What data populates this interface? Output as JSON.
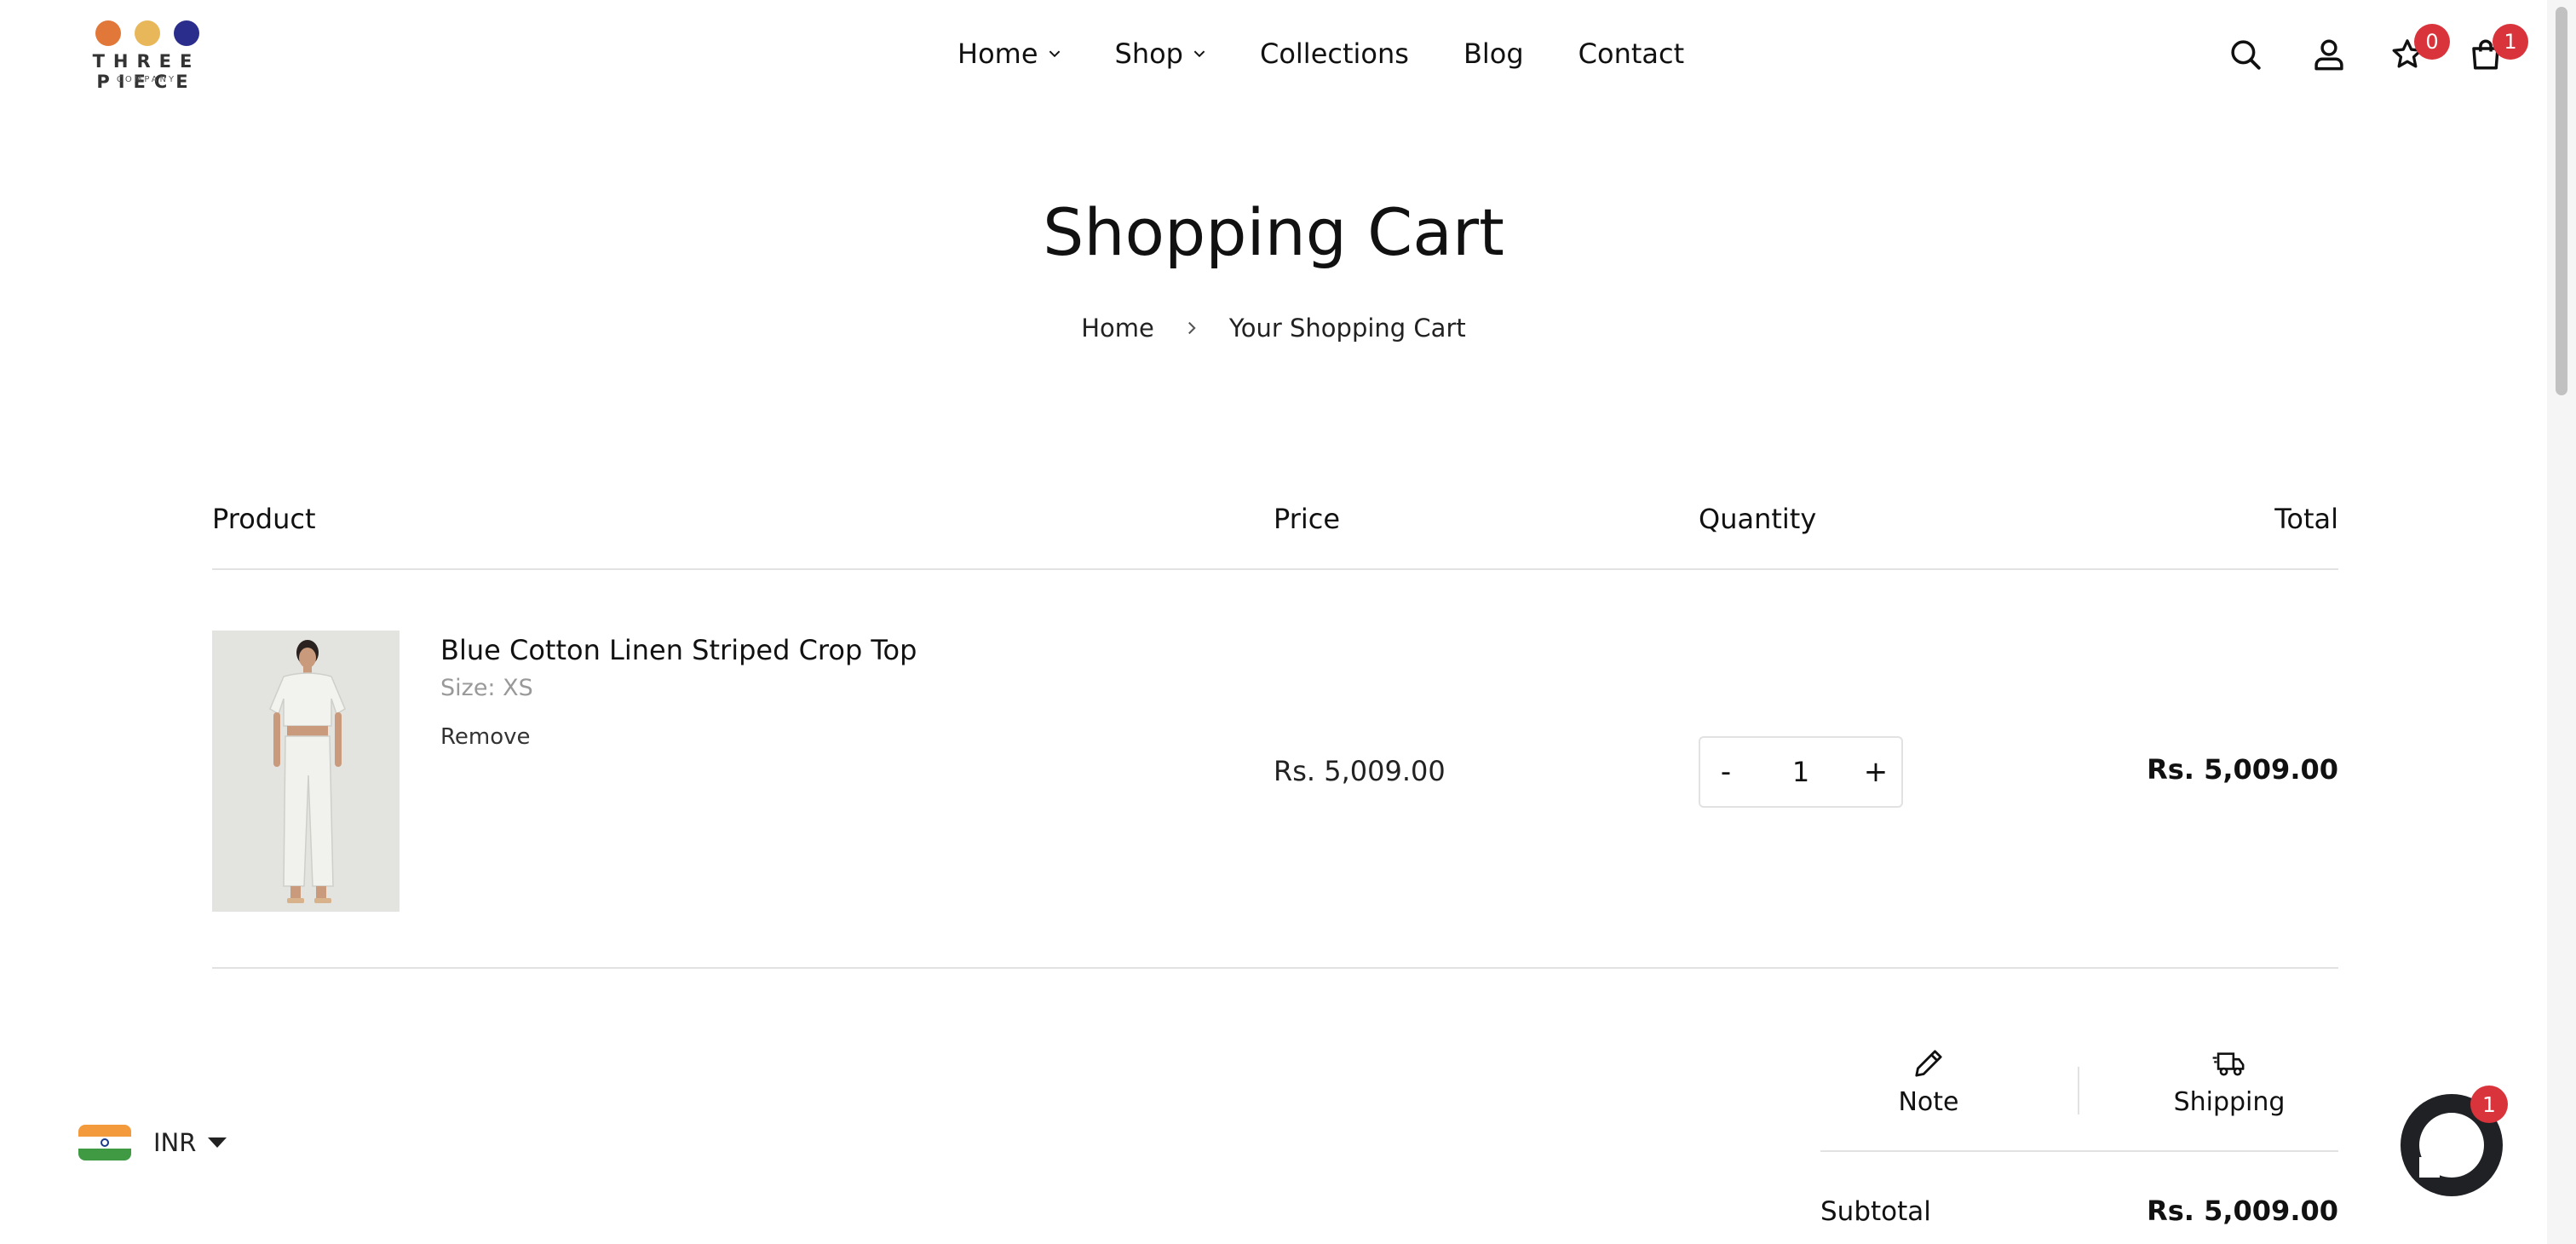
{
  "brand": {
    "name": "THREE PIECE",
    "tagline": "COMPANY",
    "dot_colors": [
      "#e2773a",
      "#e8b75a",
      "#2a2d8c"
    ]
  },
  "nav": {
    "items": [
      {
        "label": "Home",
        "has_dropdown": true
      },
      {
        "label": "Shop",
        "has_dropdown": true
      },
      {
        "label": "Collections",
        "has_dropdown": false
      },
      {
        "label": "Blog",
        "has_dropdown": false
      },
      {
        "label": "Contact",
        "has_dropdown": false
      }
    ]
  },
  "header_icons": {
    "search": "search-icon",
    "account": "user-icon",
    "wishlist": "star-icon",
    "wishlist_count": "0",
    "cart": "shopping-bag-icon",
    "cart_count": "1"
  },
  "page": {
    "title": "Shopping Cart",
    "breadcrumb": [
      "Home",
      "Your Shopping Cart"
    ]
  },
  "cart": {
    "columns": {
      "product": "Product",
      "price": "Price",
      "quantity": "Quantity",
      "total": "Total"
    },
    "items": [
      {
        "name": "Blue Cotton Linen Striped Crop Top",
        "variant": "Size: XS",
        "remove_label": "Remove",
        "price": "Rs. 5,009.00",
        "quantity": "1",
        "total": "Rs. 5,009.00"
      }
    ],
    "qty_minus": "-",
    "qty_plus": "+"
  },
  "summary": {
    "note_label": "Note",
    "shipping_label": "Shipping",
    "subtotal_label": "Subtotal",
    "subtotal_value": "Rs. 5,009.00"
  },
  "currency": {
    "code": "INR",
    "flag": "india-flag-icon"
  },
  "chat": {
    "badge": "1"
  },
  "colors": {
    "badge": "#d9343c",
    "chat": "#1f2125",
    "rule": "#e2e2e2"
  }
}
